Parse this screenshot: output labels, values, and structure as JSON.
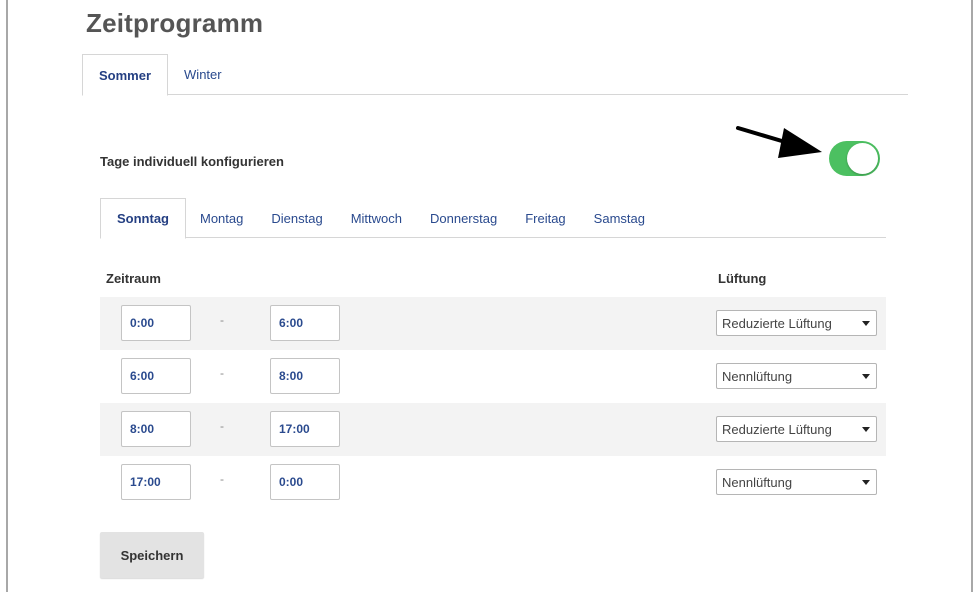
{
  "title": "Zeitprogramm",
  "season_tabs": [
    {
      "label": "Sommer",
      "active": true
    },
    {
      "label": "Winter",
      "active": false
    }
  ],
  "config": {
    "label": "Tage individuell konfigurieren",
    "toggle_on": true,
    "toggle_color": "#4cc061"
  },
  "day_tabs": [
    {
      "label": "Sonntag",
      "active": true
    },
    {
      "label": "Montag",
      "active": false
    },
    {
      "label": "Dienstag",
      "active": false
    },
    {
      "label": "Mittwoch",
      "active": false
    },
    {
      "label": "Donnerstag",
      "active": false
    },
    {
      "label": "Freitag",
      "active": false
    },
    {
      "label": "Samstag",
      "active": false
    }
  ],
  "columns": {
    "period": "Zeitraum",
    "ventilation": "Lüftung"
  },
  "rows": [
    {
      "from": "0:00",
      "separator": "-",
      "to": "6:00",
      "ventilation": "Reduzierte Lüftung"
    },
    {
      "from": "6:00",
      "separator": "-",
      "to": "8:00",
      "ventilation": "Nennlüftung"
    },
    {
      "from": "8:00",
      "separator": "-",
      "to": "17:00",
      "ventilation": "Reduzierte Lüftung"
    },
    {
      "from": "17:00",
      "separator": "-",
      "to": "0:00",
      "ventilation": "Nennlüftung"
    }
  ],
  "save_label": "Speichern",
  "accent_color": "#2a4a8e"
}
